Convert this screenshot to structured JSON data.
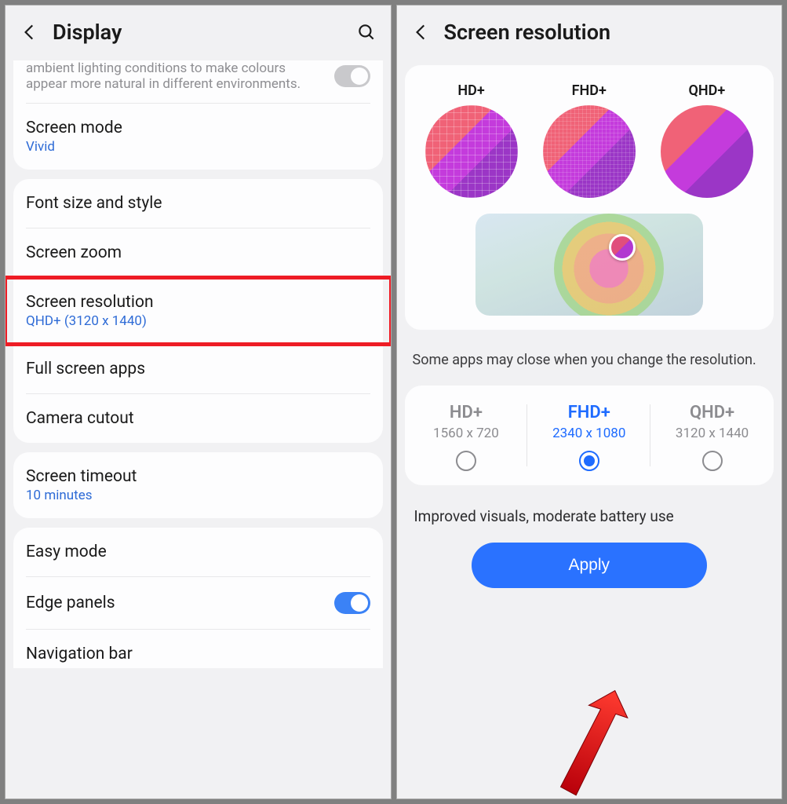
{
  "left": {
    "title": "Display",
    "adaptive_desc": "ambient lighting conditions to make colours appear more natural in different environments.",
    "screen_mode": {
      "title": "Screen mode",
      "value": "Vivid"
    },
    "font_row": "Font size and style",
    "zoom_row": "Screen zoom",
    "resolution": {
      "title": "Screen resolution",
      "value": "QHD+ (3120 x 1440)"
    },
    "full_screen": "Full screen apps",
    "camera_cutout": "Camera cutout",
    "timeout": {
      "title": "Screen timeout",
      "value": "10 minutes"
    },
    "easy_mode": "Easy mode",
    "edge_panels": "Edge panels",
    "nav_bar": "Navigation bar"
  },
  "right": {
    "title": "Screen resolution",
    "previews": [
      "HD+",
      "FHD+",
      "QHD+"
    ],
    "warning": "Some apps may close when you change the resolution.",
    "options": [
      {
        "name": "HD+",
        "dim": "1560 x 720"
      },
      {
        "name": "FHD+",
        "dim": "2340 x 1080"
      },
      {
        "name": "QHD+",
        "dim": "3120 x 1440"
      }
    ],
    "selected_index": 1,
    "summary": "Improved visuals, moderate battery use",
    "apply": "Apply"
  }
}
